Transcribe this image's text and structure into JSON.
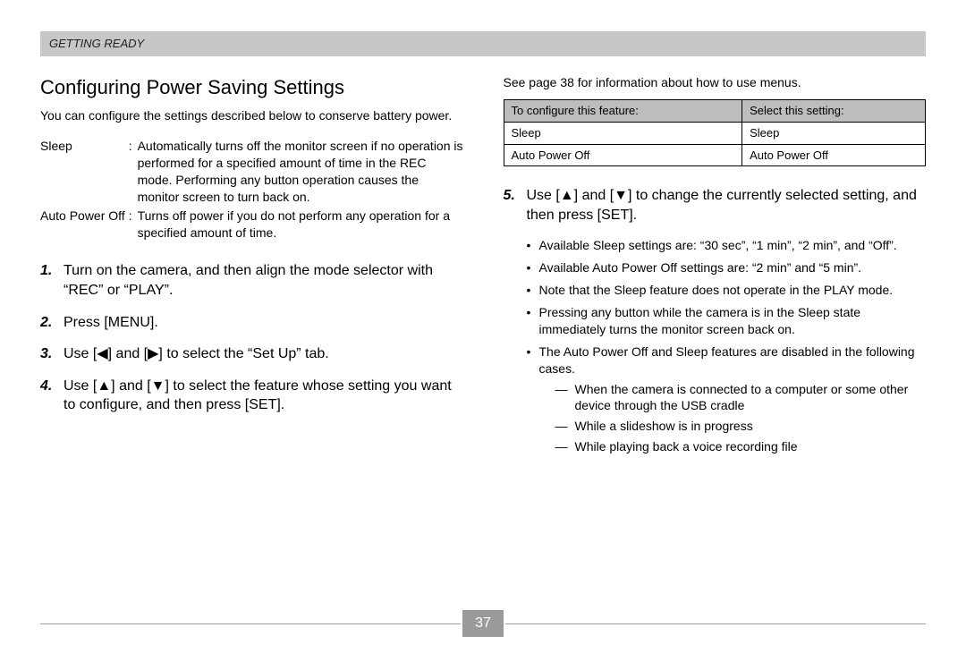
{
  "header": {
    "breadcrumb": "GETTING READY"
  },
  "left": {
    "title": "Configuring Power Saving Settings",
    "intro": "You can configure the settings described below to conserve battery power.",
    "defs": [
      {
        "term": "Sleep",
        "sep": ":",
        "desc": "Automatically turns off the monitor screen if no operation is performed for a specified amount of time in the REC mode. Performing any button operation causes the monitor screen to turn back on."
      },
      {
        "term": "Auto Power Off",
        "sep": ":",
        "desc": "Turns off power if you do not perform any operation for a specified amount of time."
      }
    ],
    "steps": [
      "Turn on the camera, and then align the mode selector with “REC” or “PLAY”.",
      "Press [MENU].",
      "Use [◀] and [▶] to select the “Set Up” tab.",
      "Use [▲] and [▼] to select the feature whose setting you want to configure, and then press [SET]."
    ]
  },
  "right": {
    "cross_ref": "See page 38 for information about how to use menus.",
    "table": {
      "headers": [
        "To configure this feature:",
        "Select this setting:"
      ],
      "rows": [
        [
          "Sleep",
          "Sleep"
        ],
        [
          "Auto Power Off",
          "Auto Power Off"
        ]
      ]
    },
    "step5": "Use [▲] and [▼] to change the currently selected setting, and then press [SET].",
    "bullets": [
      "Available Sleep settings are: “30 sec”, “1 min”, “2 min”, and “Off”.",
      "Available Auto Power Off settings are: “2 min” and “5 min”.",
      "Note that the Sleep feature does not operate in the PLAY mode.",
      "Pressing any button while the camera is in the Sleep state immediately turns the monitor screen back on.",
      "The Auto Power Off and Sleep features are disabled in the following cases."
    ],
    "dashes": [
      "When the camera is connected to a computer or some other device through the USB cradle",
      "While a slideshow is in progress",
      "While playing back a voice recording file"
    ]
  },
  "footer": {
    "page_number": "37"
  }
}
